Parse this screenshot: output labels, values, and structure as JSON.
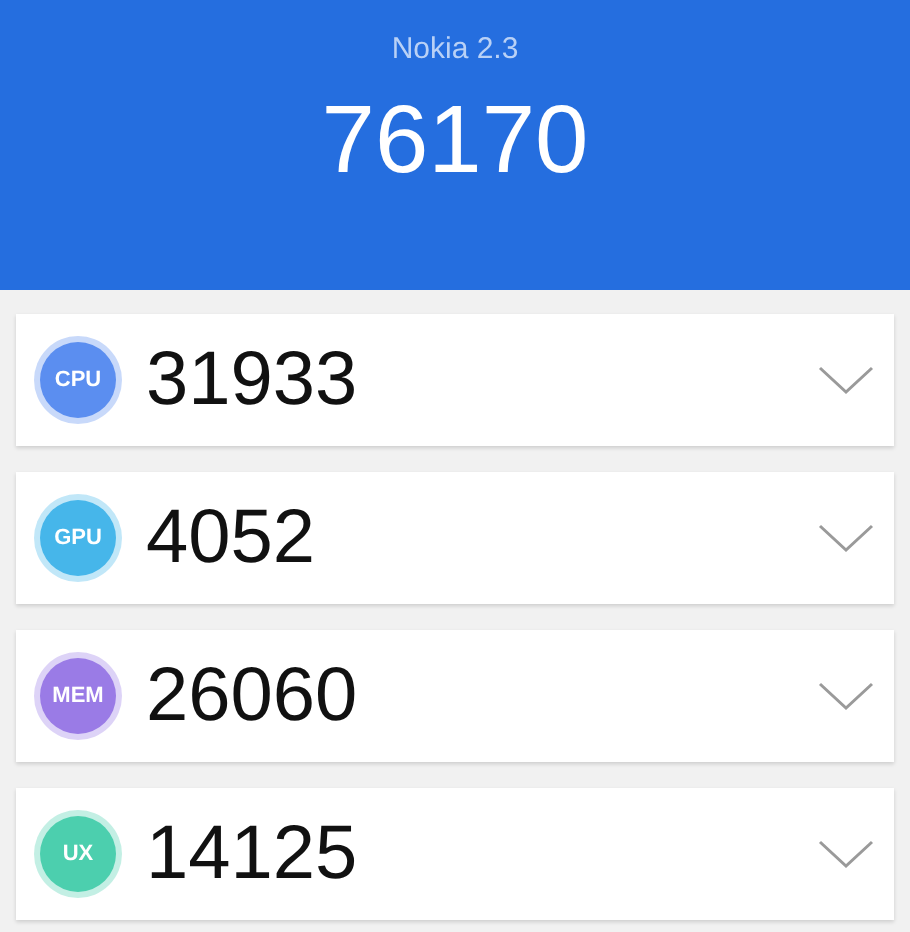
{
  "header": {
    "device": "Nokia 2.3",
    "total_score": "76170"
  },
  "scores": [
    {
      "badge": "CPU",
      "score": "31933",
      "color": "#5b8ef0"
    },
    {
      "badge": "GPU",
      "score": "4052",
      "color": "#46b6ea"
    },
    {
      "badge": "MEM",
      "score": "26060",
      "color": "#9a7be6"
    },
    {
      "badge": "UX",
      "score": "14125",
      "color": "#4ccfae"
    }
  ]
}
